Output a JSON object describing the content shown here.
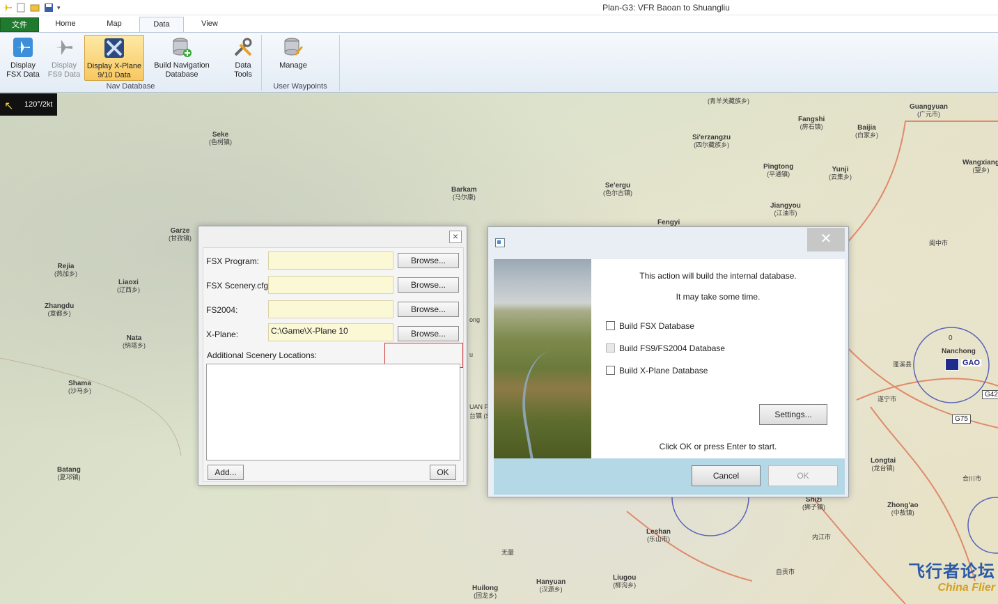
{
  "window": {
    "title": "Plan-G3: VFR Baoan to Shuangliu"
  },
  "tabs": {
    "file": "文件",
    "home": "Home",
    "map": "Map",
    "data": "Data",
    "view": "View"
  },
  "ribbon": {
    "display_fsx": "Display\nFSX Data",
    "display_fs9": "Display\nFS9 Data",
    "display_xplane": "Display X-Plane\n9/10 Data",
    "build_nav": "Build Navigation\nDatabase",
    "data_tools": "Data\nTools",
    "manage": "Manage",
    "group_nav": "Nav Database",
    "group_waypoints": "User Waypoints"
  },
  "map": {
    "wind": "120°/2kt",
    "places": [
      {
        "name": "Seke",
        "sub": "(色柯镇)"
      },
      {
        "name": "Barkam",
        "sub": "(马尔康)"
      },
      {
        "name": "Garze",
        "sub": "(甘孜镇)"
      },
      {
        "name": "Rejia",
        "sub": "(热加乡)"
      },
      {
        "name": "Liaoxi",
        "sub": "(辽西乡)"
      },
      {
        "name": "Zhangdu",
        "sub": "(章都乡)"
      },
      {
        "name": "Nata",
        "sub": "(纳塔乡)"
      },
      {
        "name": "Shama",
        "sub": "(沙马乡)"
      },
      {
        "name": "Batang",
        "sub": "(夏邛镇)"
      },
      {
        "name": "Fangshi",
        "sub": "(房石镇)"
      },
      {
        "name": "Si'erzangzu",
        "sub": "(四尔藏族乡)"
      },
      {
        "name": "Pingtong",
        "sub": "(平通镇)"
      },
      {
        "name": "Se'ergu",
        "sub": "(色尔古镇)"
      },
      {
        "name": "Jiangyou",
        "sub": "(江油市)"
      },
      {
        "name": "Yunji",
        "sub": "(云集乡)"
      },
      {
        "name": "Baijia",
        "sub": "(白家乡)"
      },
      {
        "name": "Guangyuan",
        "sub": "(广元市)"
      },
      {
        "name": "Wangxiang",
        "sub": "(望乡)"
      },
      {
        "name": "Fengyi",
        "sub": ""
      },
      {
        "name": "Nanchong",
        "sub": ""
      },
      {
        "name": "Longtai",
        "sub": "(龙台镇)"
      },
      {
        "name": "Leshan",
        "sub": "(乐山市)"
      },
      {
        "name": "Shizi",
        "sub": "(狮子镇)"
      },
      {
        "name": "Zhong'ao",
        "sub": "(中敖镇)"
      },
      {
        "name": "Liugou",
        "sub": "(柳沟乡)"
      },
      {
        "name": "Hanyuan",
        "sub": "(汉源乡)"
      },
      {
        "name": "Huilong",
        "sub": "(回龙乡)"
      }
    ],
    "extra_labels": {
      "nancong_cn": "阆中市",
      "suining": "遂宁市",
      "penglai": "蓬溪县",
      "hechuan": "合川市",
      "neijiang": "内江市",
      "zigong": "自贡市",
      "gao": "GAO",
      "road_g42": "G42",
      "road_g75": "G75",
      "north": "0",
      "clipped_ong": "ong",
      "clipped_uanp": "UAN P",
      "clipped_tai": "台镇 (S",
      "clipped_u": "u",
      "clipped_jia": "嘉",
      "clipped_wu": "无量",
      "clipped_top": "(青羊关藏族乡)"
    }
  },
  "dialog_paths": {
    "fsx_program_label": "FSX Program:",
    "fsx_scenery_label": "FSX Scenery.cfg:",
    "fs2004_label": "FS2004:",
    "xplane_label": "X-Plane:",
    "fsx_program_value": "",
    "fsx_scenery_value": "",
    "fs2004_value": "",
    "xplane_value": "C:\\Game\\X-Plane 10",
    "browse": "Browse...",
    "additional_label": "Additional Scenery Locations:",
    "add": "Add...",
    "ok": "OK",
    "close": "×"
  },
  "dialog_build": {
    "line1": "This action will build the internal database.",
    "line2": "It may take some time.",
    "chk_fsx": "Build FSX Database",
    "chk_fs9": "Build FS9/FS2004 Database",
    "chk_xplane": "Build X-Plane Database",
    "settings": "Settings...",
    "hint": "Click OK or press Enter to start.",
    "cancel": "Cancel",
    "ok": "OK",
    "close": "✕"
  },
  "watermark": {
    "cn": "飞行者论坛",
    "en": "China Flier"
  }
}
